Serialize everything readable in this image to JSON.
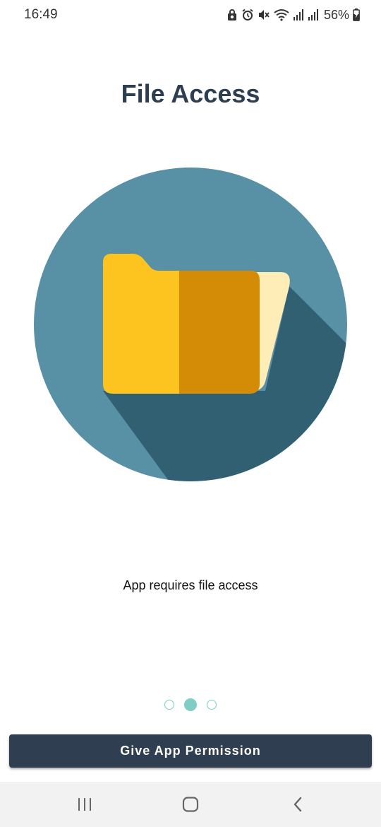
{
  "status_bar": {
    "time": "16:49",
    "battery_percent": "56%",
    "icons": [
      "recycle-lock-icon",
      "alarm-icon",
      "mute-icon",
      "wifi-icon",
      "signal-icon",
      "signal-icon",
      "battery-charging-icon"
    ]
  },
  "screen": {
    "title": "File Access",
    "illustration": "folder-icon",
    "message": "App requires file access"
  },
  "pager": {
    "total": 3,
    "active_index": 1
  },
  "actions": {
    "primary_label": "Give App Permission"
  },
  "nav_bar": {
    "buttons": [
      "recent-apps",
      "home",
      "back"
    ]
  },
  "colors": {
    "title": "#2c3e50",
    "circle": "#5890a6",
    "circle_shadow": "#316073",
    "folder_back": "#fdc41f",
    "folder_front": "#d48c07",
    "paper": "#ffedb8",
    "dot": "#7fcdc4",
    "button": "#2f3e50"
  }
}
